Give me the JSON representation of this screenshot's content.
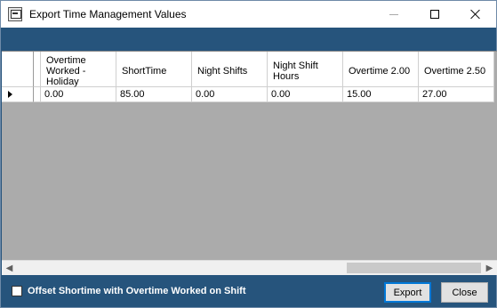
{
  "window": {
    "title": "Export Time Management Values",
    "icon": "app-window-icon"
  },
  "grid": {
    "columns": [
      {
        "label": "Overtime Worked - Holiday"
      },
      {
        "label": "ShortTime"
      },
      {
        "label": "Night Shifts"
      },
      {
        "label": "Night Shift Hours"
      },
      {
        "label": "Overtime 2.00"
      },
      {
        "label": "Overtime 2.50"
      }
    ],
    "rows": [
      {
        "values": [
          "0.00",
          "85.00",
          "0.00",
          "0.00",
          "15.00",
          "27.00"
        ]
      }
    ]
  },
  "options": {
    "offset_label": "Offset Shortime with Overtime Worked on Shift",
    "offset_checked": false
  },
  "buttons": {
    "export_label": "Export",
    "close_label": "Close"
  }
}
